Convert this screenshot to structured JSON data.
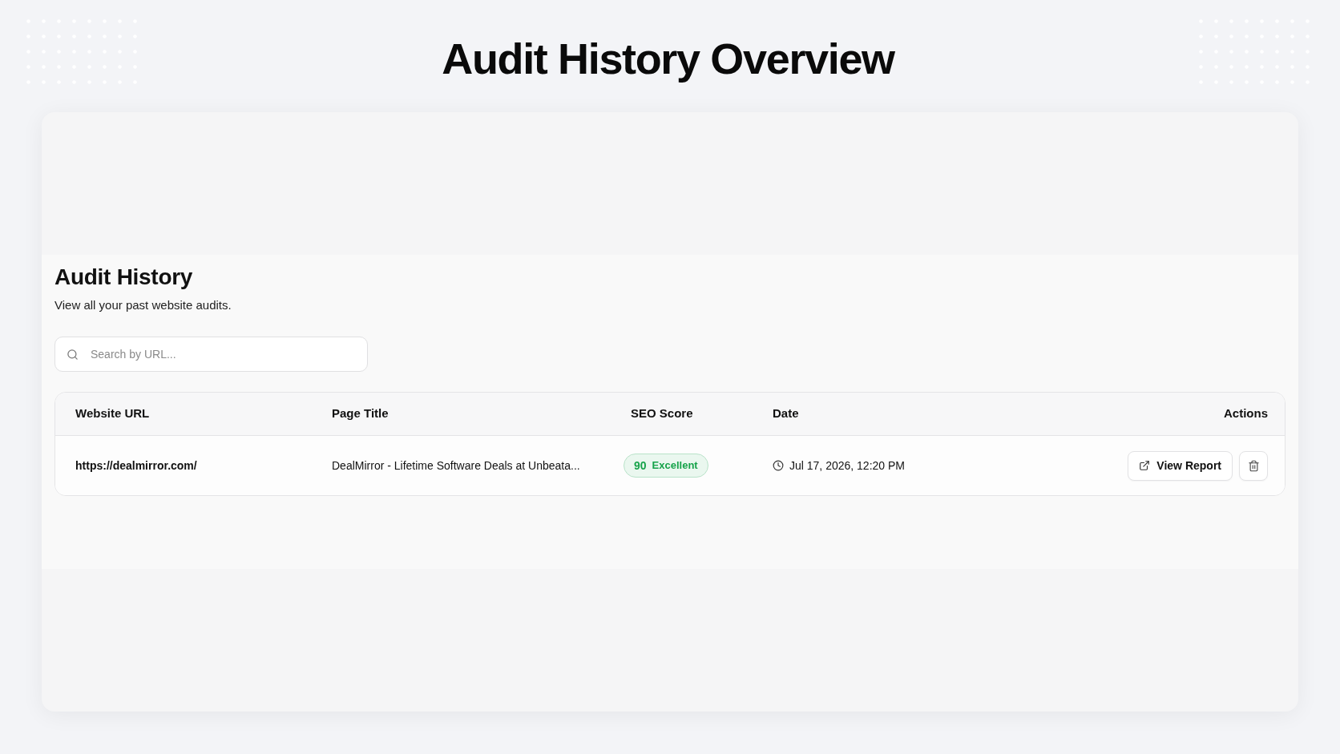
{
  "page": {
    "title": "Audit History Overview"
  },
  "panel": {
    "title": "Audit History",
    "subtitle": "View all your past website audits."
  },
  "search": {
    "placeholder": "Search by URL..."
  },
  "table": {
    "columns": [
      "Website URL",
      "Page Title",
      "SEO Score",
      "Date",
      "Actions"
    ],
    "rows": [
      {
        "url": "https://dealmirror.com/",
        "page_title": "DealMirror - Lifetime Software Deals at Unbeata...",
        "score": "90",
        "rating": "Excellent",
        "color": "#16a34a",
        "date": "Jul 17, 2026, 12:20 PM",
        "view_button": "View Report"
      }
    ]
  }
}
